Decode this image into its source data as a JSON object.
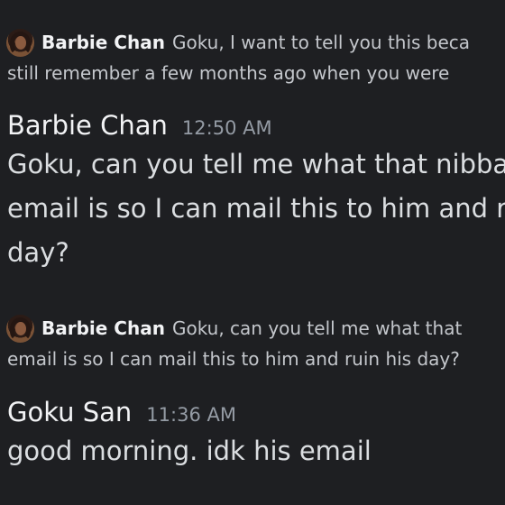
{
  "replies": [
    {
      "author": "Barbie Chan",
      "line1": "Goku, I want to tell you this beca",
      "line2": "still remember a few months ago when you were"
    },
    {
      "author": "Barbie Chan",
      "line1": "Goku, can you tell me what that",
      "line2": "email is so I can mail this to him and ruin his day?"
    }
  ],
  "messages": [
    {
      "author": "Barbie Chan",
      "time": "12:50 AM",
      "lines": [
        "Goku, can you tell me what that nibba",
        "email is so I can mail this to him and ru",
        "day?"
      ]
    },
    {
      "author": "Goku San",
      "time": "11:36 AM",
      "lines": [
        "good morning. idk his email"
      ]
    }
  ]
}
